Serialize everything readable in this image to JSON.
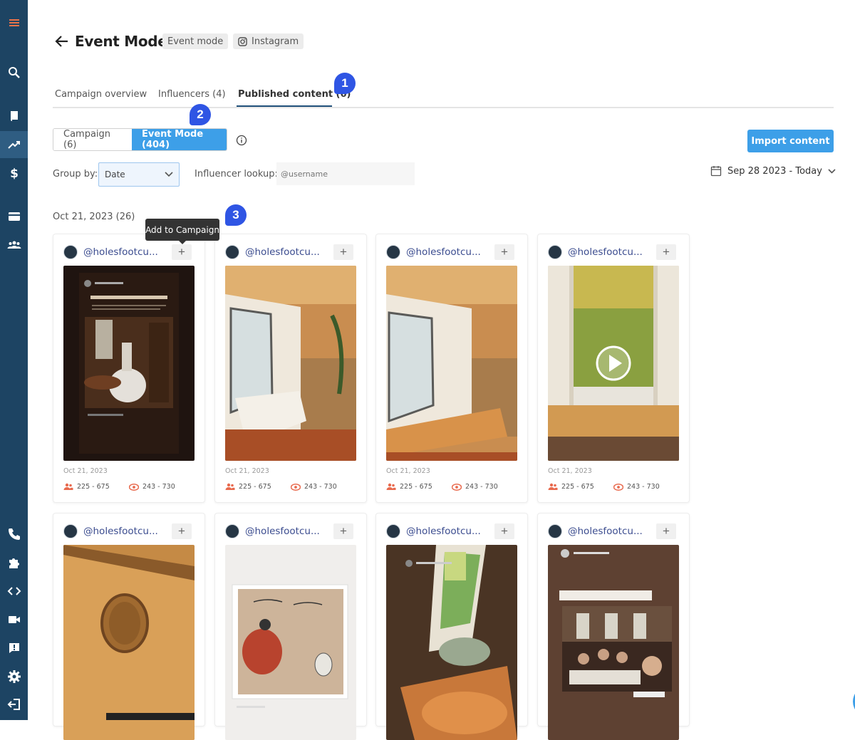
{
  "colors": {
    "sidebar": "#1d4463",
    "primary": "#3d9fe8",
    "badge": "#2f55e4",
    "handle": "#3b4c8f"
  },
  "sidebar": {
    "items": [
      {
        "icon": "menu-icon"
      },
      {
        "icon": "search-icon"
      },
      {
        "icon": "book-icon"
      },
      {
        "icon": "trending-icon"
      },
      {
        "icon": "dollar-icon"
      },
      {
        "icon": "credit-card-icon"
      },
      {
        "icon": "users-icon"
      },
      {
        "icon": "phone-icon"
      },
      {
        "icon": "puzzle-icon"
      },
      {
        "icon": "code-icon"
      },
      {
        "icon": "video-icon"
      },
      {
        "icon": "feedback-icon"
      },
      {
        "icon": "settings-icon"
      },
      {
        "icon": "logout-icon"
      }
    ]
  },
  "header": {
    "title": "Event Mode",
    "tags": [
      {
        "label": "Event mode"
      },
      {
        "label": "Instagram",
        "icon": "instagram-icon"
      }
    ]
  },
  "tabs": [
    {
      "label": "Campaign overview"
    },
    {
      "label": "Influencers (4)"
    },
    {
      "label": "Published content (6)",
      "active": true
    }
  ],
  "badges": [
    "1",
    "2",
    "3"
  ],
  "segment": [
    {
      "label": "Campaign (6)"
    },
    {
      "label": "Event Mode (404)",
      "active": true
    }
  ],
  "import_button": "Import content",
  "filters": {
    "group_by_label": "Group by:",
    "group_by_value": "Date",
    "lookup_label": "Influencer lookup:",
    "lookup_placeholder": "@username",
    "date_range": "Sep 28 2023 - Today"
  },
  "group": {
    "title": "Oct 21, 2023 (26)"
  },
  "tooltip": "Add to Campaign",
  "cards": [
    {
      "handle": "@holesfootcu...",
      "date": "Oct 21, 2023",
      "reach": "225 - 675",
      "views": "243 - 730",
      "thumb": "story-dress"
    },
    {
      "handle": "@holesfootcu...",
      "date": "Oct 21, 2023",
      "reach": "225 - 675",
      "views": "243 - 730",
      "thumb": "window-bath"
    },
    {
      "handle": "@holesfootcu...",
      "date": "Oct 21, 2023",
      "reach": "225 - 675",
      "views": "243 - 730",
      "thumb": "window-bath"
    },
    {
      "handle": "@holesfootcu...",
      "date": "Oct 21, 2023",
      "reach": "225 - 675",
      "views": "243 - 730",
      "thumb": "window-video"
    },
    {
      "handle": "@holesfootcu...",
      "thumb": "wood-emblem"
    },
    {
      "handle": "@holesfootcu...",
      "thumb": "painting"
    },
    {
      "handle": "@holesfootcu...",
      "thumb": "bathroom-story"
    },
    {
      "handle": "@holesfootcu...",
      "thumb": "party-story"
    }
  ]
}
